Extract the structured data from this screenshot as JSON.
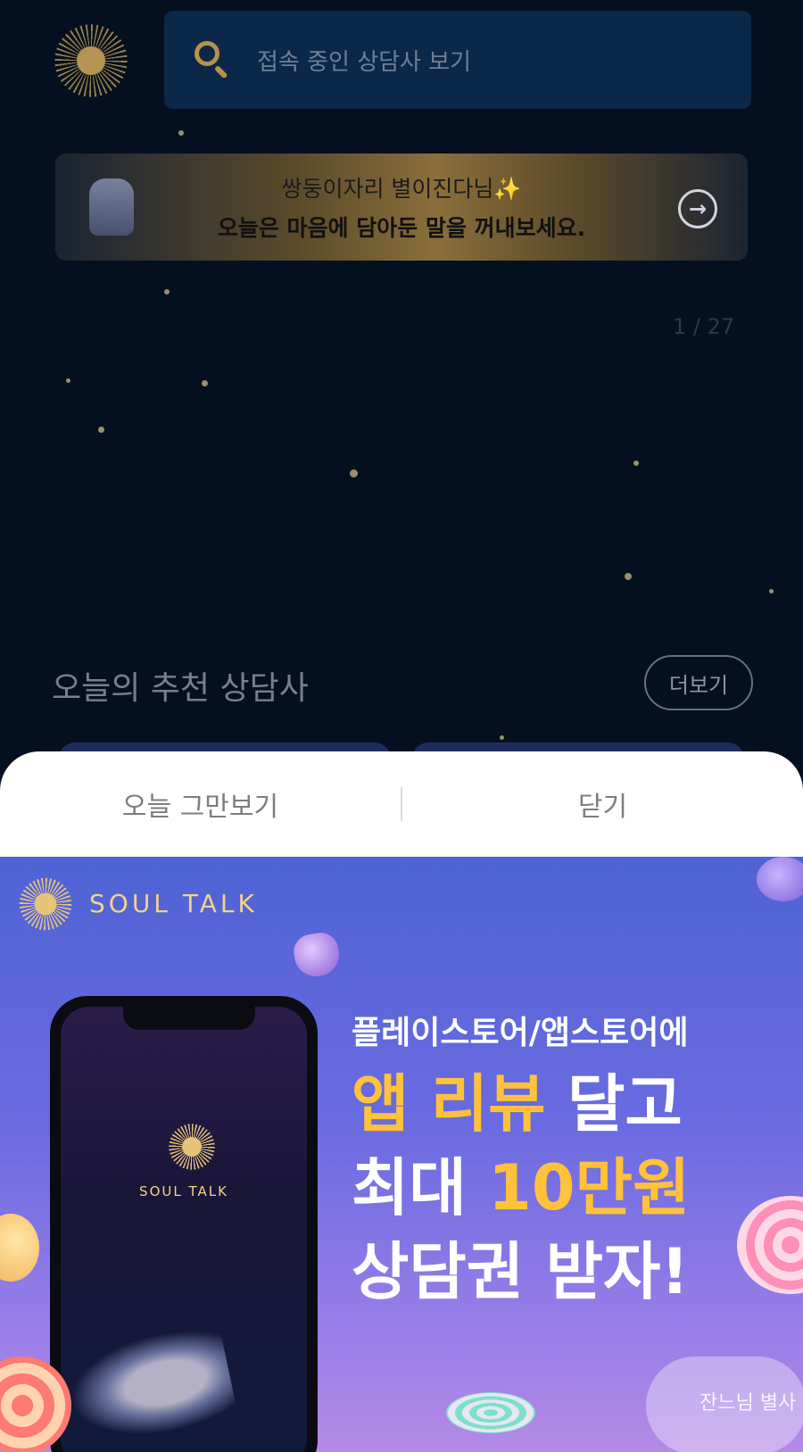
{
  "search": {
    "placeholder": "접속 중인 상담사 보기"
  },
  "banner": {
    "line1": "쌍둥이자리 별이진다님",
    "sparkle": "✨",
    "line2": "오늘은 마음에 담아둔 말을 꺼내보세요.",
    "arrow": "→"
  },
  "pager": "1 / 27",
  "recommended": {
    "title": "오늘의 추천 상담사",
    "more": "더보기"
  },
  "sheet": {
    "dont_show_today": "오늘 그만보기",
    "close": "닫기"
  },
  "promo": {
    "brand": "SOUL TALK",
    "phone_brand": "SOUL TALK",
    "line1": "플레이스토어/앱스토어에",
    "line2_hl": "앱 리뷰",
    "line2": " 달고",
    "line3_pre": "최대 ",
    "line3_hl": "10만원",
    "line4": "상담권 받자!",
    "watermark": "잔느님 별사"
  },
  "colors": {
    "highlight": "#ffc23a",
    "brand_gold": "#f0d38c",
    "bg": "#04101f"
  }
}
